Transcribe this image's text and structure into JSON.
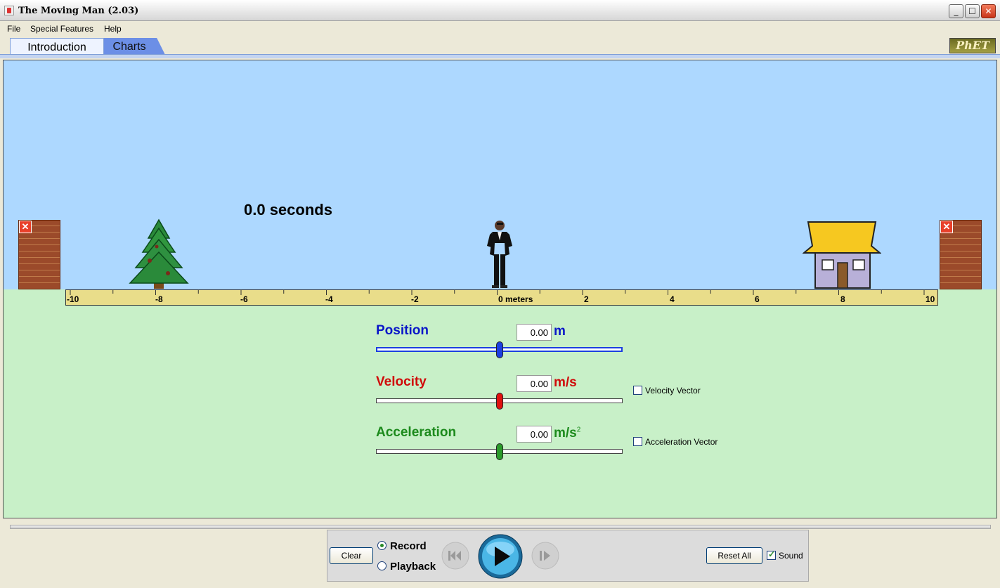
{
  "window": {
    "title": "The Moving Man (2.03)"
  },
  "menu": [
    "File",
    "Special Features",
    "Help"
  ],
  "tabs": [
    "Introduction",
    "Charts"
  ],
  "logo_text": "PhET",
  "sim": {
    "time_readout": "0.0 seconds",
    "ruler": {
      "labels": [
        "-10",
        "-8",
        "-6",
        "-4",
        "-2",
        "0 meters",
        "2",
        "4",
        "6",
        "8",
        "10"
      ]
    }
  },
  "controls": {
    "position": {
      "label": "Position",
      "value": "0.00",
      "unit": "m",
      "color": "#0a16c8",
      "thumb_color": "#1c3fe0"
    },
    "velocity": {
      "label": "Velocity",
      "value": "0.00",
      "unit": "m/s",
      "color": "#d00a0a",
      "thumb_color": "#e01010",
      "vector_label": "Velocity Vector"
    },
    "acceleration": {
      "label": "Acceleration",
      "value": "0.00",
      "unit": "m/s",
      "unit_sup": "2",
      "color": "#1c8a1c",
      "thumb_color": "#2a9a2a",
      "vector_label": "Acceleration Vector"
    }
  },
  "playback": {
    "clear": "Clear",
    "record": "Record",
    "playback": "Playback",
    "reset_all": "Reset All",
    "sound": "Sound"
  }
}
